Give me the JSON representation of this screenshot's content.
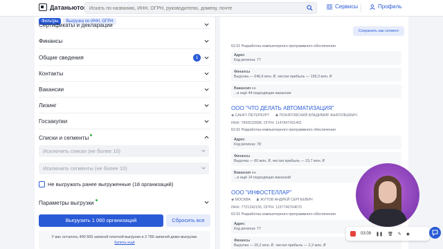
{
  "header": {
    "logo_text": "Датаньютон",
    "search_placeholder": "Искать по названию, ИНН, ОГРН, руководителю, домену, почте",
    "services_label": "Сервисы",
    "profile_label": "Профиль"
  },
  "filters": {
    "tabs": [
      {
        "label": "Фильтры",
        "active": true
      },
      {
        "label": "Выгрузка по ИНН, ОГРН",
        "active": false
      }
    ],
    "sections": [
      {
        "label": "Сертификаты и декларации"
      },
      {
        "label": "Финансы"
      },
      {
        "label": "Общие сведения",
        "badge": "1"
      },
      {
        "label": "Контакты"
      },
      {
        "label": "Вакансии"
      },
      {
        "label": "Лизинг"
      },
      {
        "label": "Госзакупки"
      },
      {
        "label": "Списки и сегменты"
      }
    ],
    "exclude_lists_placeholder": "Исключить списки (не более 10)",
    "exclude_segments_placeholder": "Исключить сегменты (не более 10)",
    "checkbox_label": "Не выгружать ранее выгруженные (18 организаций)",
    "export_params_label": "Параметры выгрузки",
    "export_button": "Выгрузить 1 060 организаций",
    "reset_button": "Сбросить все",
    "notice_line1": "У вас осталось 490 505 записей платной выгрузки и 2 780 записей демо-выгрузки.",
    "notice_link": "Купить ещё"
  },
  "results": {
    "save_segment_button": "Сохранить как сегмент",
    "okved_top": "62.01 Разработка компьютерного программного обеспечения",
    "card0_address_title": "Адрес",
    "card0_address_value": "Код региона: 77",
    "card0_finance_title": "Финансы",
    "card0_finance_value": "Выручка — 646,6 млн. ₽, чистая прибыль — 159,3 млн. ₽",
    "card0_vac_title": "Вакансия «»",
    "card0_vac_value": "...и ещё 44 подходящие вакансии",
    "company1_name": "ООО \"ЧТО ДЕЛАТЬ АВТОМАТИЗАЦИЯ\"",
    "company1_city": "САНКТ-ПЕТЕРБУРГ",
    "company1_head": "ПОНЯТОВСКИЙ ВЛАДИМИР АНАТОЛЬЕВИЧ",
    "company1_ids": "ИНН: 7842532898, ОГРН: 1147847431401",
    "company1_okved": "62.01 Разработка компьютерного программного обеспечения",
    "card1_address_title": "Адрес",
    "card1_address_value": "Код региона: 78",
    "card1_finance_title": "Финансы",
    "card1_finance_value": "Выручка — 60 млн. ₽, чистая прибыль — 15,7 млн. ₽",
    "card1_vac_title": "Вакансия «»",
    "card1_vac_value": "...и ещё 14 подходящих вакансий",
    "company2_name": "ООО \"ИНФОСТЕЛЛАР\"",
    "company2_city": "МОСКВА",
    "company2_head": "ЖУТОВ АНДРЕЙ СЕРГЕЕВИЧ",
    "company2_ids": "ИНН: 7721342155, ОГРН: 1157746764670",
    "company2_okved": "62.01 Разработка компьютерного программного обеспечения",
    "card2_address_title": "Адрес",
    "card2_address_value": "Код региона: 77",
    "card2_finance_title": "Финансы",
    "card2_finance_value": "Выручка — 26,2 млн. ₽, чистая прибыль — 2,2 млн. ₽"
  },
  "recorder": {
    "time": "03:09"
  },
  "colors": {
    "accent": "#2a5bd7",
    "record": "#e5433b",
    "new_dot": "#31b046"
  }
}
